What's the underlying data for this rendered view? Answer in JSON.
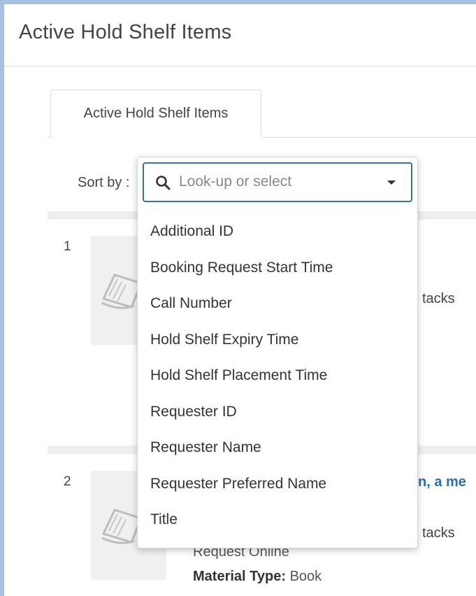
{
  "page": {
    "title": "Active Hold Shelf Items"
  },
  "tabs": [
    {
      "label": "Active Hold Shelf Items"
    }
  ],
  "sort": {
    "label": "Sort by :",
    "placeholder": "Look-up or select",
    "options": [
      "Additional ID",
      "Booking Request Start Time",
      "Call Number",
      "Hold Shelf Expiry Time",
      "Hold Shelf Placement Time",
      "Requester ID",
      "Requester Name",
      "Requester Preferred Name",
      "Title"
    ]
  },
  "items": [
    {
      "number": "1",
      "location_peek": "tacks"
    },
    {
      "number": "2",
      "title_peek": "n, a me",
      "location_peek": "tacks",
      "request_peek": "Request Online",
      "material_type_label": "Material Type:",
      "material_type_value": "Book"
    }
  ],
  "icons": {
    "search": "search-icon",
    "dropdown": "chevron-down-icon",
    "thumbnail": "book-icon"
  }
}
